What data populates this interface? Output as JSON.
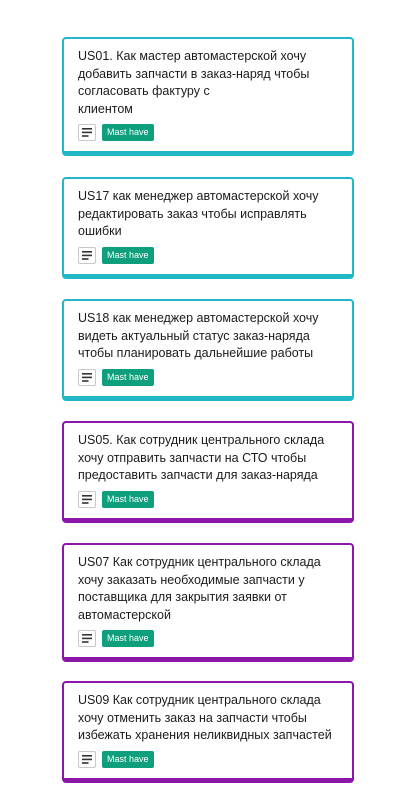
{
  "board": {
    "cards": [
      {
        "title": "US01. Как мастер автомастерской хочу\nдобавить запчасти в заказ-наряд чтобы\nсогласовать фактуру с\nклиентом",
        "label": "Mast have",
        "label_color": "#0e9f7c",
        "accent": "#20b8c8",
        "icon": "description-icon"
      },
      {
        "title": "US17 как менеджер автомастерской хочу\nредактировать заказ чтобы исправлять\nошибки",
        "label": "Mast have",
        "label_color": "#0e9f7c",
        "accent": "#20b8c8",
        "icon": "description-icon"
      },
      {
        "title": "US18 как менеджер автомастерской хочу\nвидеть актуальный статус заказ-наряда\nчтобы планировать дальнейшие работы",
        "label": "Mast have",
        "label_color": "#0e9f7c",
        "accent": "#20b8c8",
        "icon": "description-icon"
      },
      {
        "title": "US05. Как сотрудник центрального склада\nхочу отправить запчасти на СТО чтобы\nпредоставить запчасти для заказ-наряда",
        "label": "Mast have",
        "label_color": "#0e9f7c",
        "accent": "#8c16a8",
        "icon": "description-icon"
      },
      {
        "title": "US07 Как сотрудник центрального склада\nхочу заказать необходимые запчасти у\nпоставщика для закрытия заявки от\nавтомастерской",
        "label": "Mast have",
        "label_color": "#0e9f7c",
        "accent": "#8c16a8",
        "icon": "description-icon"
      },
      {
        "title": "US09 Как сотрудник центрального склада\nхочу отменить заказ на запчасти чтобы\nизбежать хранения неликвидных запчастей",
        "label": "Mast have",
        "label_color": "#0e9f7c",
        "accent": "#8c16a8",
        "icon": "description-icon"
      }
    ]
  }
}
